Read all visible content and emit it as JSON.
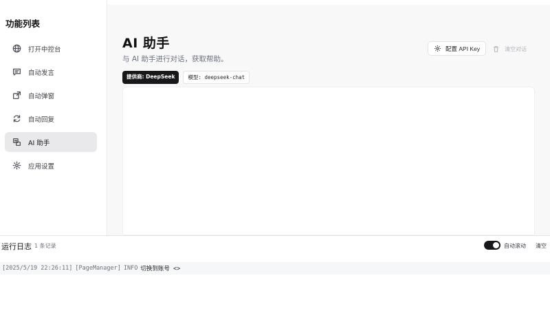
{
  "sidebar": {
    "title": "功能列表",
    "items": [
      {
        "label": "打开中控台",
        "icon": "globe-icon",
        "active": false
      },
      {
        "label": "自动发言",
        "icon": "message-icon",
        "active": false
      },
      {
        "label": "自动弹窗",
        "icon": "popup-icon",
        "active": false
      },
      {
        "label": "自动回复",
        "icon": "refresh-icon",
        "active": false
      },
      {
        "label": "AI 助手",
        "icon": "ai-chat-icon",
        "active": true
      },
      {
        "label": "应用设置",
        "icon": "gear-icon",
        "active": false
      }
    ]
  },
  "main": {
    "title": "AI 助手",
    "subtitle": "与 AI 助手进行对话，获取帮助。",
    "provider_badge": "提供商: DeepSeek",
    "model_badge": "模型: deepseek-chat",
    "config_button": "配置 API Key",
    "clear_chat_button": "清空对话"
  },
  "log": {
    "title": "运行日志",
    "count": "1 条记录",
    "auto_scroll_label": "自动滚动",
    "auto_scroll_on": true,
    "clear_button": "清空",
    "entries": [
      {
        "time": "[2025/5/19 22:26:11]",
        "source": "[PageManager]",
        "level": "INFO",
        "message": "切换到账号 <>"
      }
    ]
  },
  "colors": {
    "accent": "#18181b",
    "active_nav_bg": "#e9e9eb",
    "main_bg": "#f8f8f9"
  }
}
